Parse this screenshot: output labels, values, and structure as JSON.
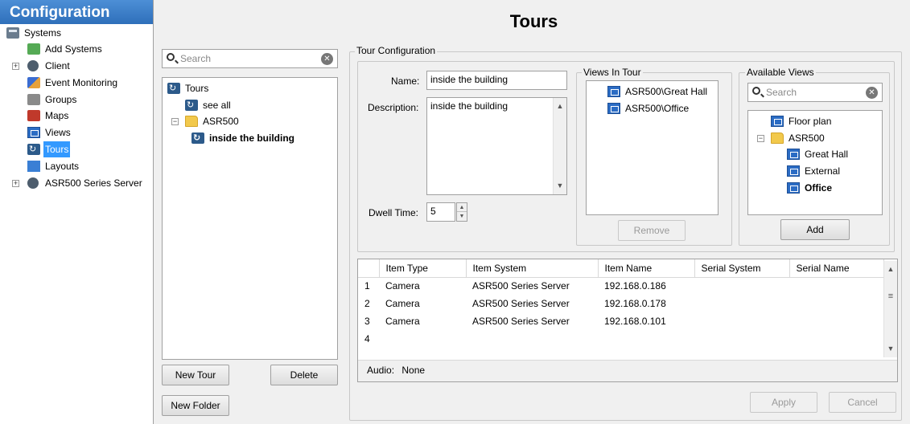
{
  "sidebar": {
    "header": "Configuration",
    "items": [
      {
        "label": "Systems",
        "icon": "systems-icon"
      },
      {
        "label": "Add Systems",
        "icon": "add-systems-icon"
      },
      {
        "label": "Client",
        "icon": "gear-icon"
      },
      {
        "label": "Event Monitoring",
        "icon": "event-monitoring-icon"
      },
      {
        "label": "Groups",
        "icon": "groups-icon"
      },
      {
        "label": "Maps",
        "icon": "map-icon"
      },
      {
        "label": "Views",
        "icon": "view-icon"
      },
      {
        "label": "Tours",
        "icon": "tour-icon",
        "selected": true
      },
      {
        "label": "Layouts",
        "icon": "layout-icon"
      },
      {
        "label": "ASR500 Series Server",
        "icon": "server-icon"
      }
    ]
  },
  "page": {
    "title": "Tours"
  },
  "tours_tree": {
    "search_placeholder": "Search",
    "items": [
      "Tours",
      "see all",
      "ASR500",
      "inside the building"
    ],
    "new_tour": "New Tour",
    "delete": "Delete",
    "new_folder": "New Folder"
  },
  "config": {
    "group_label": "Tour Configuration",
    "name_label": "Name:",
    "name_value": "inside the building",
    "description_label": "Description:",
    "description_value": "inside the building",
    "dwell_label": "Dwell Time:",
    "dwell_value": "5"
  },
  "views_in_tour": {
    "label": "Views In Tour",
    "items": [
      "ASR500\\Great Hall",
      "ASR500\\Office"
    ],
    "remove": "Remove"
  },
  "available_views": {
    "label": "Available Views",
    "search_placeholder": "Search",
    "items": [
      "Floor plan",
      "ASR500",
      "Great Hall",
      "External",
      "Office"
    ],
    "add": "Add"
  },
  "table": {
    "columns": [
      "Item Type",
      "Item System",
      "Item Name",
      "Serial System",
      "Serial Name"
    ],
    "rows": [
      {
        "num": "1",
        "type": "Camera",
        "system": "ASR500 Series Server",
        "name": "192.168.0.186"
      },
      {
        "num": "2",
        "type": "Camera",
        "system": "ASR500 Series Server",
        "name": "192.168.0.178"
      },
      {
        "num": "3",
        "type": "Camera",
        "system": "ASR500 Series Server",
        "name": "192.168.0.101"
      },
      {
        "num": "4",
        "type": "",
        "system": "",
        "name": ""
      }
    ],
    "audio_label": "Audio:",
    "audio_value": "None"
  },
  "footer": {
    "apply": "Apply",
    "cancel": "Cancel"
  }
}
